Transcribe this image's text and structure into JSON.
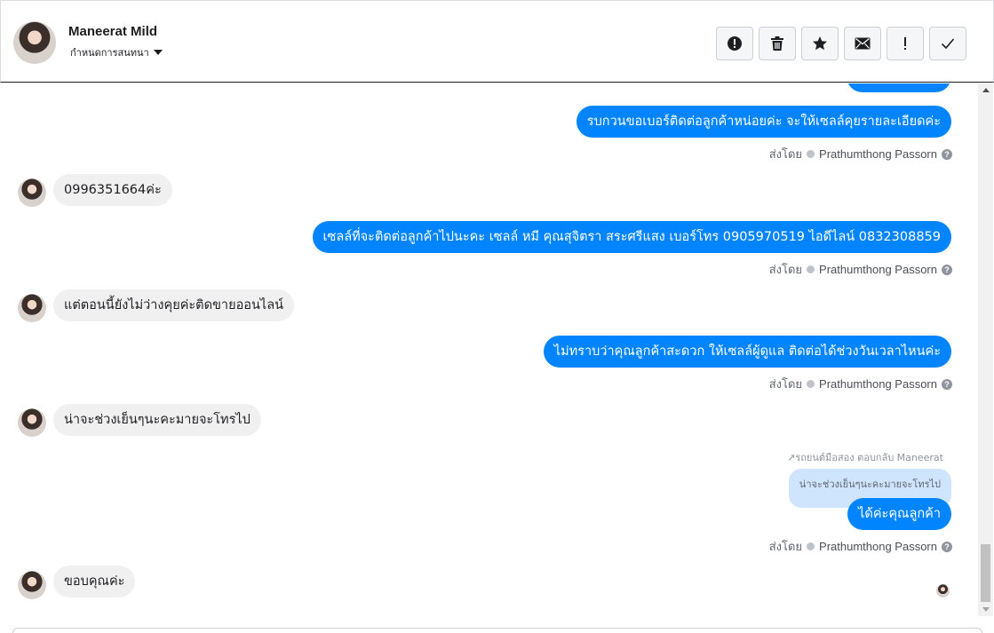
{
  "header": {
    "name": "Maneerat Mild",
    "subtitle": "กำหนดการสนทนา",
    "toolbar": [
      {
        "name": "spam-button",
        "icon": "alert-circle-icon"
      },
      {
        "name": "delete-button",
        "icon": "trash-icon"
      },
      {
        "name": "star-button",
        "icon": "star-icon"
      },
      {
        "name": "mark-unread-button",
        "icon": "envelope-icon"
      },
      {
        "name": "follow-up-button",
        "icon": "exclamation-icon"
      },
      {
        "name": "mark-done-button",
        "icon": "checkmark-icon"
      }
    ]
  },
  "thread": {
    "messages": [
      {
        "dir": "out",
        "text": "รบกวนขอเบอร์ติดต่อลูกค้าหน่อยค่ะ จะให้เซลล์คุยรายละเอียดค่ะ",
        "sent_by_label": "ส่งโดย",
        "sender": "Prathumthong Passorn"
      },
      {
        "dir": "in",
        "text": "0996351664ค่ะ"
      },
      {
        "dir": "out",
        "text": "เซลล์ที่จะติดต่อลูกค้าไปนะคะ เซลล์ หมี คุณสุจิตรา สระศรีแสง เบอร์โทร 0905970519 ไอดีไลน์ 0832308859",
        "sent_by_label": "ส่งโดย",
        "sender": "Prathumthong Passorn"
      },
      {
        "dir": "in",
        "text": "แต่ตอนนี้ยังไม่ว่างคุยค่ะติดขายออนไลน์"
      },
      {
        "dir": "out",
        "text": "ไม่ทราบว่าคุณลูกค้าสะดวก ให้เซลล์ผู้ดูแล ติดต่อได้ช่วงวันเวลาไหนค่ะ",
        "sent_by_label": "ส่งโดย",
        "sender": "Prathumthong Passorn"
      },
      {
        "dir": "in",
        "text": "น่าจะช่วงเย็นๆนะคะมายจะโทรไป"
      },
      {
        "dir": "out",
        "reply_meta": "↗รถยนต์มือสอง ตอบกลับ Maneerat",
        "quoted": "น่าจะช่วงเย็นๆนะคะมายจะโทรไป",
        "text": "ได้ค่ะคุณลูกค้า",
        "sent_by_label": "ส่งโดย",
        "sender": "Prathumthong Passorn"
      },
      {
        "dir": "in",
        "text": "ขอบคุณค่ะ"
      }
    ]
  },
  "colors": {
    "outgoing_bubble": "#0084ff",
    "incoming_bubble": "#f1f0f0",
    "quoted_bubble": "#cfe5fd"
  }
}
